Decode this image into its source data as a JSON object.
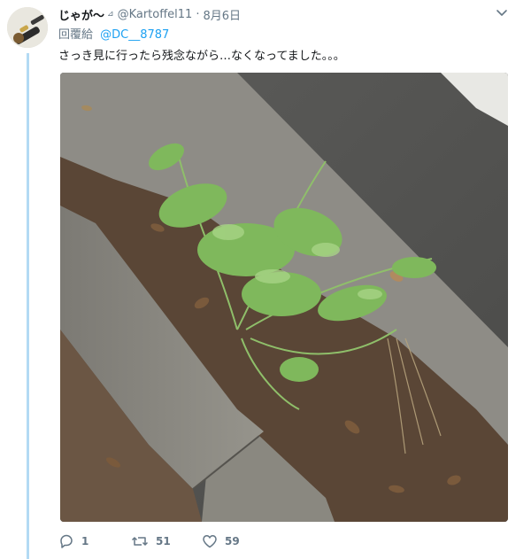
{
  "tweet": {
    "display_name": "じゃが〜",
    "badge": "⊿",
    "handle": "@Kartoffel11",
    "separator": "·",
    "time": "8月6日",
    "reply_label": "回覆給",
    "reply_mention": "@DC__8787",
    "text": "さっき見に行ったら残念ながら…なくなってました。。。",
    "stats": {
      "replies": "1",
      "retweets": "51",
      "likes": "59"
    }
  },
  "icons": {
    "more": "chevron-down-icon",
    "reply": "reply-icon",
    "retweet": "retweet-icon",
    "like": "heart-icon"
  },
  "colors": {
    "link": "#1da1f2",
    "muted": "#657786",
    "thread_line": "#b3daf4"
  }
}
